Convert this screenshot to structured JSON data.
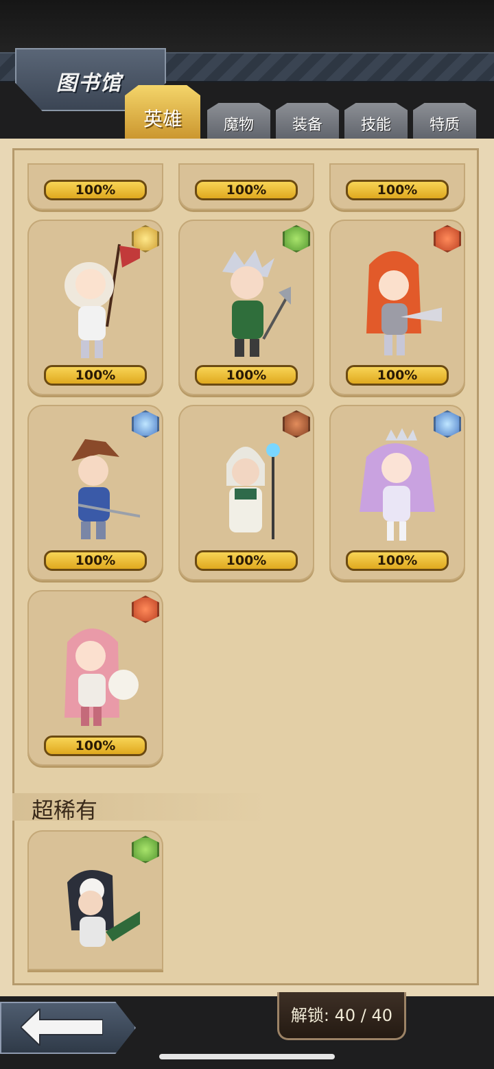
{
  "header": {
    "title": "图书馆"
  },
  "tabs": [
    {
      "label": "英雄",
      "active": true
    },
    {
      "label": "魔物",
      "active": false
    },
    {
      "label": "装备",
      "active": false
    },
    {
      "label": "技能",
      "active": false
    },
    {
      "label": "特质",
      "active": false
    }
  ],
  "grid": {
    "top_row_partial": [
      {
        "progress": "100%"
      },
      {
        "progress": "100%"
      },
      {
        "progress": "100%"
      }
    ],
    "cards": [
      {
        "element_icon": "light-element-icon",
        "progress": "100%"
      },
      {
        "element_icon": "wind-element-icon",
        "progress": "100%"
      },
      {
        "element_icon": "fire-element-icon",
        "progress": "100%"
      },
      {
        "element_icon": "water-element-icon",
        "progress": "100%"
      },
      {
        "element_icon": "dark-element-icon",
        "progress": "100%"
      },
      {
        "element_icon": "water-element-icon",
        "progress": "100%"
      },
      {
        "element_icon": "fire-element-icon",
        "progress": "100%"
      }
    ]
  },
  "section": {
    "title": "超稀有"
  },
  "section_cards": [
    {
      "element_icon": "wind-element-icon"
    }
  ],
  "footer": {
    "unlock_label": "解锁: 40 / 40"
  },
  "colors": {
    "progress_fill": "#f0c33a",
    "panel": "#e3cfa6",
    "active_tab": "#e6b84a"
  }
}
